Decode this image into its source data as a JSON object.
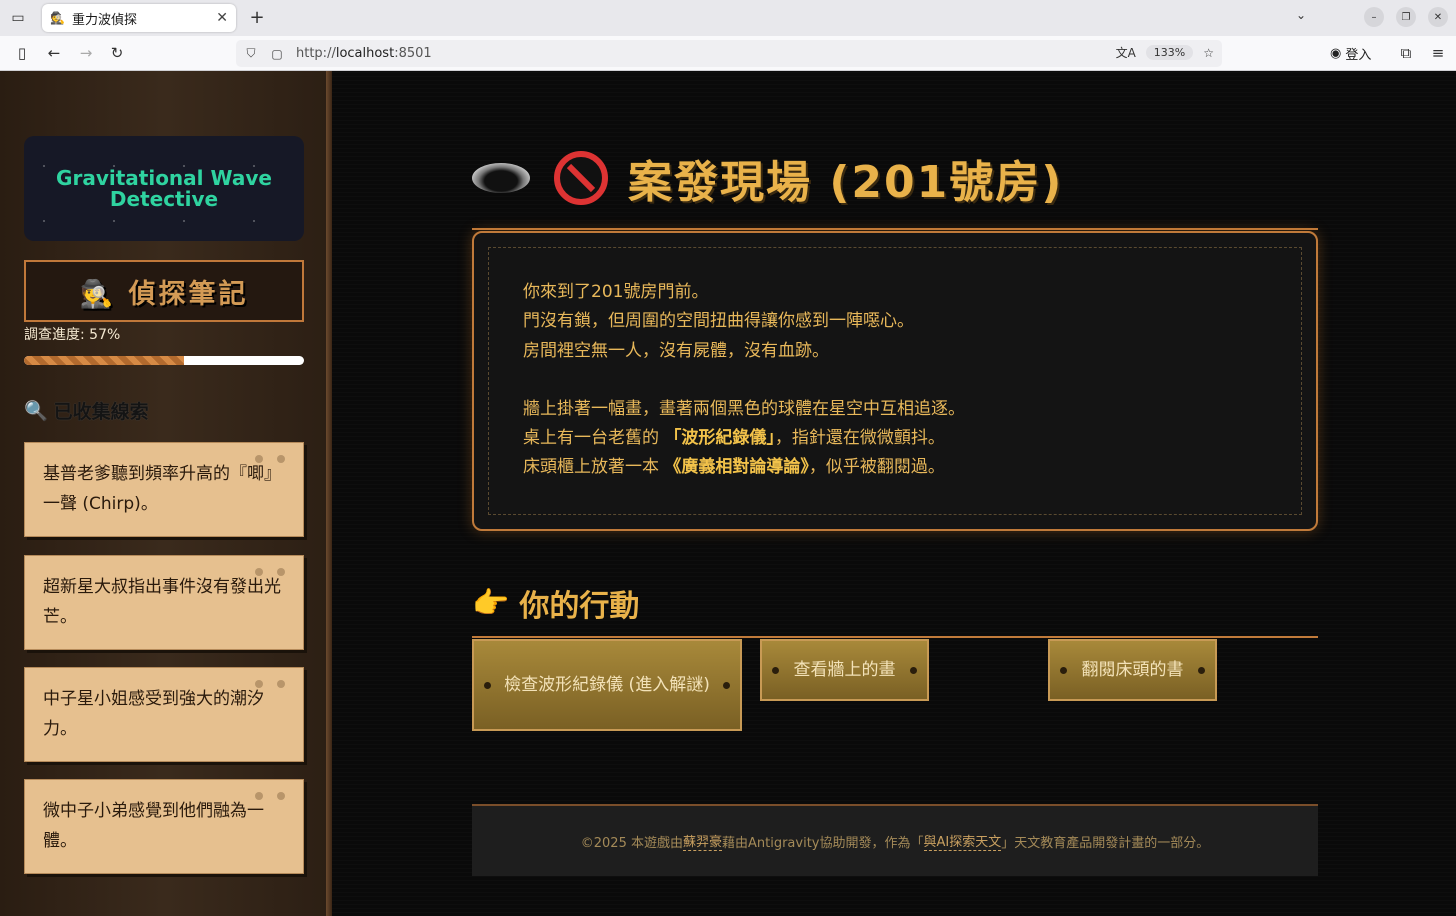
{
  "browser": {
    "tab_title": "重力波偵探",
    "tab_favicon": "🕵",
    "url_prefix": "http://",
    "url_host": "localhost",
    "url_port": ":8501",
    "zoom": "133%",
    "login_label": "登入"
  },
  "sidebar": {
    "banner_title": "Gravitational Wave Detective",
    "notebook_title": "🕵️ 偵探筆記",
    "progress_label": "調查進度: 57%",
    "progress_value": 0.57,
    "clues_title": "已收集線索",
    "clues_icon": "🔍",
    "clues": [
      {
        "text": "基普老爹聽到頻率升高的『唧』一聲 (Chirp)。"
      },
      {
        "text": "超新星大叔指出事件沒有發出光芒。"
      },
      {
        "text": "中子星小姐感受到強大的潮汐力。"
      },
      {
        "text": "微中子小弟感覺到他們融為一體。"
      }
    ]
  },
  "main": {
    "title": "案發現場 (201號房)",
    "scene": {
      "line1": "你來到了201號房門前。",
      "line2": "門沒有鎖，但周圍的空間扭曲得讓你感到一陣噁心。",
      "line3": "房間裡空無一人，沒有屍體，沒有血跡。",
      "line4": "牆上掛著一幅畫，畫著兩個黑色的球體在星空中互相追逐。",
      "line5_pre": "桌上有一台老舊的",
      "line5_hl": "「波形紀錄儀」",
      "line5_post": "，指針還在微微顫抖。",
      "line6_pre": "床頭櫃上放著一本",
      "line6_hl": "《廣義相對論導論》",
      "line6_post": "，似乎被翻閱過。"
    },
    "actions_icon": "👉",
    "actions_title": "你的行動",
    "actions": [
      {
        "label": "檢查波形紀錄儀 (進入解謎)"
      },
      {
        "label": "查看牆上的畫"
      },
      {
        "label": "翻閱床頭的書"
      }
    ],
    "footer": {
      "pre": "©2025 本遊戲由",
      "author": "蘇羿豪",
      "mid": "藉由Antigravity協助開發，作為「",
      "project": "與AI探索天文",
      "post": "」天文教育產品開發計畫的一部分。"
    }
  }
}
